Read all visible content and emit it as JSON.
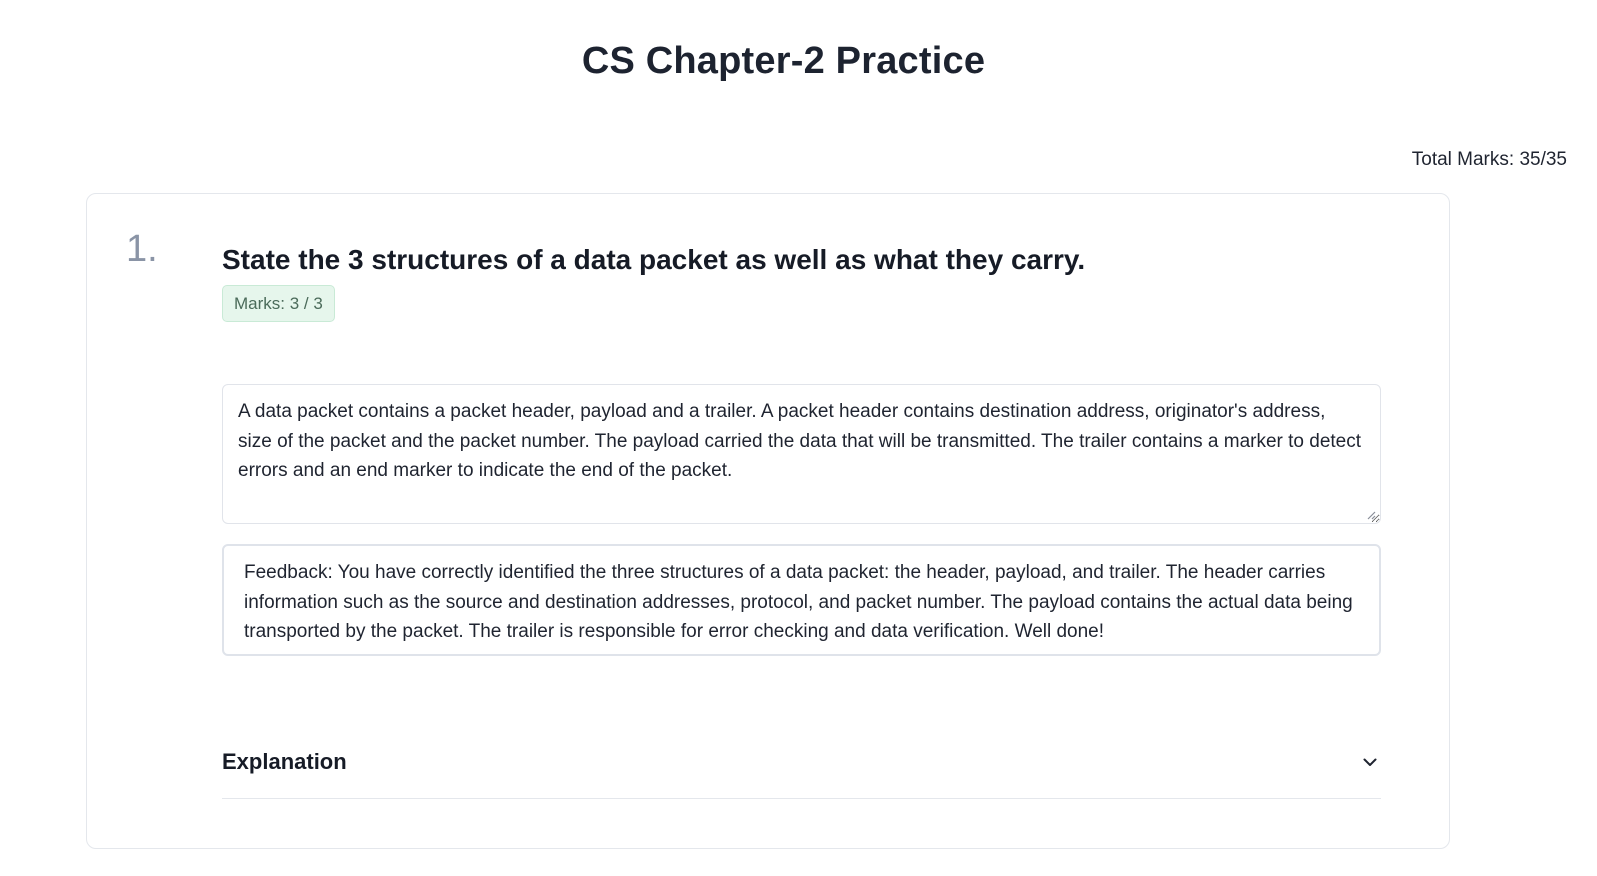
{
  "page": {
    "title": "CS Chapter-2 Practice",
    "total_marks": "Total Marks: 35/35"
  },
  "question": {
    "number": "1.",
    "text": "State the 3 structures of a data packet as well as what they carry.",
    "marks": "Marks: 3 / 3",
    "answer": "A data packet contains a packet header, payload and a trailer. A packet header contains destination address, originator's address, size of the packet and the packet number. The payload carried the data that will be transmitted. The trailer contains a marker to detect errors and an end marker to indicate the end of the packet.",
    "feedback": "Feedback: You have correctly identified the three structures of a data packet: the header, payload, and trailer. The header carries information such as the source and destination addresses, protocol, and packet number. The payload contains the actual data being transported by the packet. The trailer is responsible for error checking and data verification. Well done!",
    "explanation_label": "Explanation",
    "explanation_icon": "chevron-down-icon"
  },
  "colors": {
    "badge_bg": "#e6f6ec",
    "badge_text": "#4b6b5a",
    "question_number": "#8a94a6"
  }
}
